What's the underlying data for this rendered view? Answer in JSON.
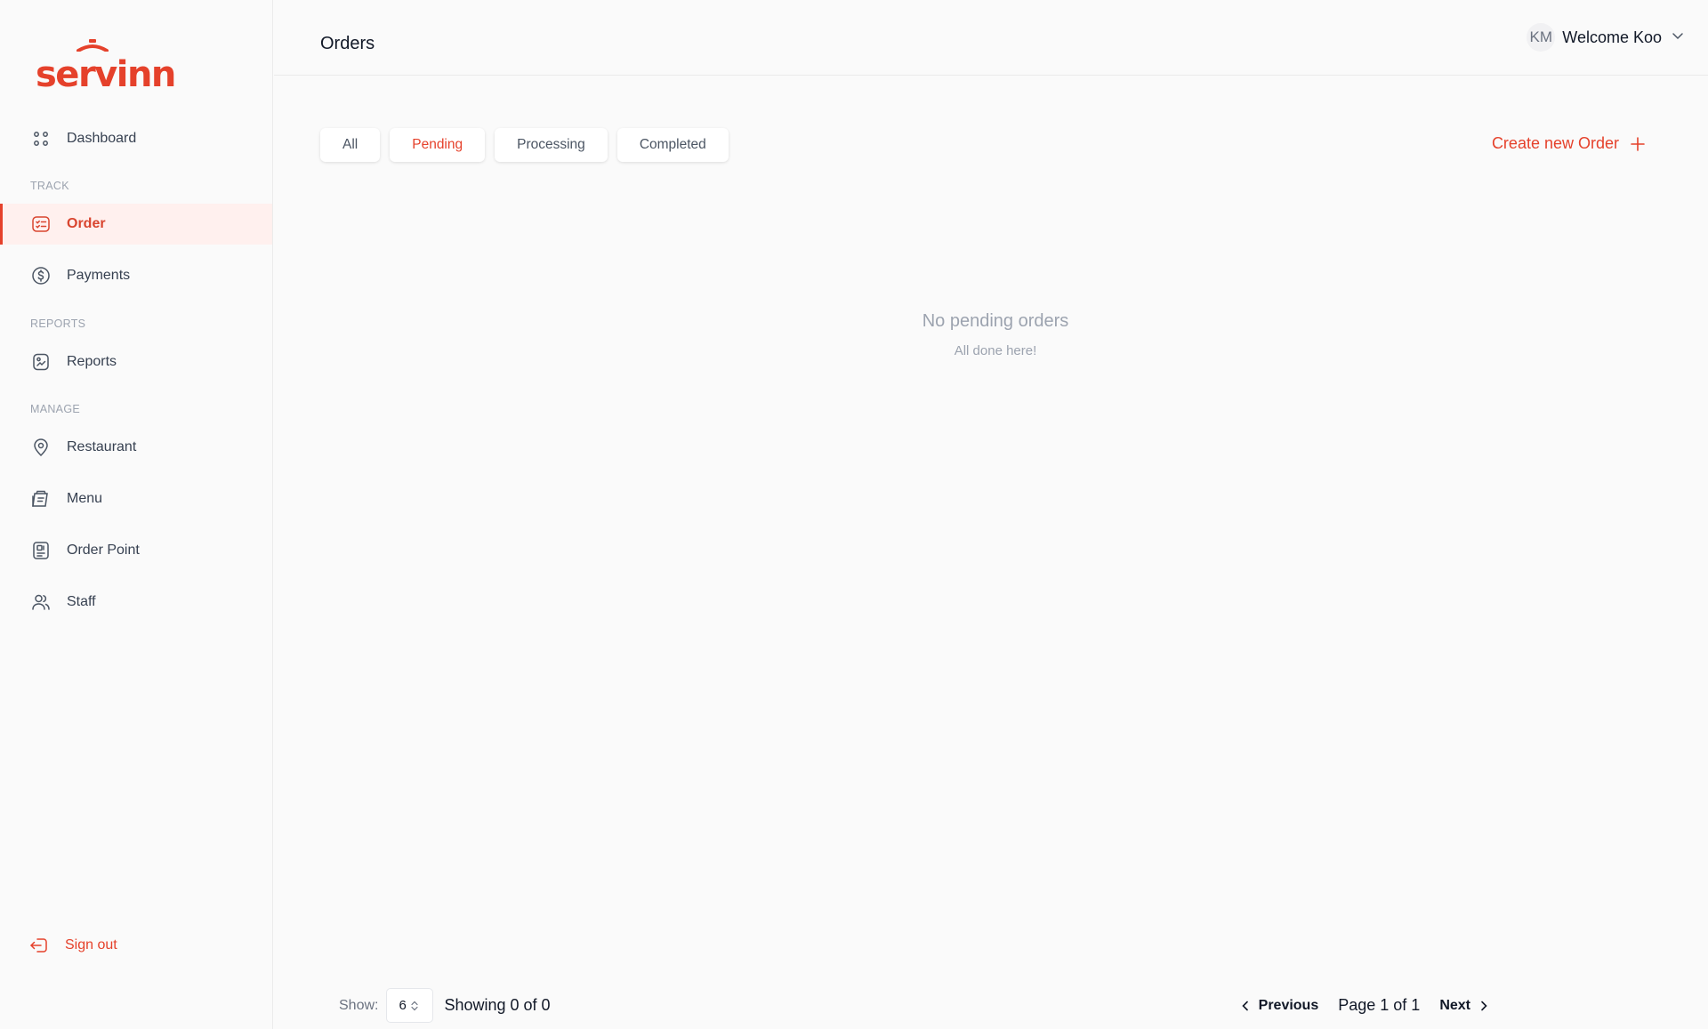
{
  "brand": {
    "name": "servinn",
    "color": "#e5412b"
  },
  "sidebar": {
    "dashboard": {
      "label": "Dashboard",
      "icon": "grid-icon"
    },
    "sections": {
      "track": "TRACK",
      "reports": "REPORTS",
      "manage": "MANAGE"
    },
    "items": [
      {
        "label": "Order",
        "icon": "order-list-icon",
        "active": true
      },
      {
        "label": "Payments",
        "icon": "dollar-circle-icon",
        "active": false
      },
      {
        "label": "Reports",
        "icon": "report-icon",
        "active": false
      },
      {
        "label": "Restaurant",
        "icon": "location-pin-icon",
        "active": false
      },
      {
        "label": "Menu",
        "icon": "menu-book-icon",
        "active": false
      },
      {
        "label": "Order Point",
        "icon": "qr-code-icon",
        "active": false
      },
      {
        "label": "Staff",
        "icon": "users-icon",
        "active": false
      }
    ],
    "signout": "Sign out"
  },
  "header": {
    "title": "Orders",
    "avatar_initials": "KM",
    "welcome": "Welcome Koo"
  },
  "tabs": [
    {
      "label": "All",
      "active": false
    },
    {
      "label": "Pending",
      "active": true
    },
    {
      "label": "Processing",
      "active": false
    },
    {
      "label": "Completed",
      "active": false
    }
  ],
  "create_order": "Create new Order",
  "empty_state": {
    "title": "No pending orders",
    "subtitle": "All done here!"
  },
  "footer": {
    "show_label": "Show:",
    "page_size": "6",
    "showing": "Showing 0 of 0",
    "previous": "Previous",
    "page_info": "Page 1 of 1",
    "next": "Next"
  }
}
